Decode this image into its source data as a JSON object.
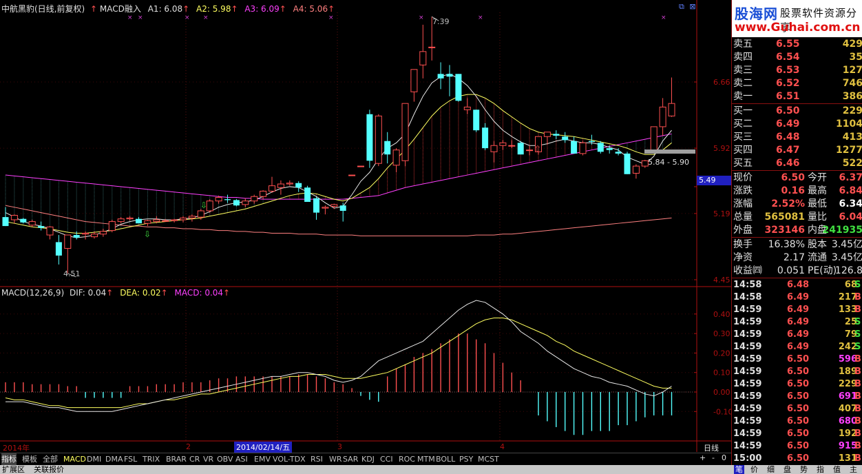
{
  "header": {
    "title": "中航黑豹(日线,前复权)",
    "indicator": "MACD融入",
    "a1": "A1: 6.08",
    "a2": "A2: 5.98",
    "a3": "A3: 6.09",
    "a4": "A4: 5.06"
  },
  "macd_header": {
    "label": "MACD(12,26,9)",
    "dif": "DIF: 0.04",
    "dea": "DEA: 0.02",
    "macd": "MACD: 0.04"
  },
  "annotations": {
    "high": "7.39",
    "low": "4.51",
    "range": "5.84 - 5.90",
    "current_price_tag": "5.49"
  },
  "x_labels": {
    "year": "2014年",
    "m2": "2",
    "date": "2014/02/14/五",
    "m3": "3",
    "m4": "4",
    "period": "日线"
  },
  "colors": {
    "up": "#ff5050",
    "down": "#54ffff",
    "ma_white": "#e8e8e8",
    "ma_yellow": "#ffff60",
    "ma_magenta": "#ff40ff",
    "ma_pink": "#ff8080",
    "axis_red": "#b01010",
    "blue_tag": "#2020c0"
  },
  "chart_data": [
    {
      "type": "candlestick",
      "title": "中航黑豹(日线,前复权)",
      "y_ticks": [
        4.45,
        5.19,
        5.49,
        5.92,
        6.66
      ],
      "ylim": [
        4.45,
        7.4
      ],
      "ohlc": [
        [
          5.15,
          5.26,
          5.05,
          5.05
        ],
        [
          5.12,
          5.18,
          5.08,
          5.17
        ],
        [
          5.13,
          5.14,
          5.08,
          5.09
        ],
        [
          5.06,
          5.12,
          5.04,
          5.1
        ],
        [
          5.05,
          5.1,
          5.0,
          5.03
        ],
        [
          4.95,
          5.05,
          4.9,
          5.04
        ],
        [
          4.87,
          4.95,
          4.62,
          4.72
        ],
        [
          4.8,
          4.95,
          4.52,
          4.95
        ],
        [
          4.95,
          4.99,
          4.9,
          4.92
        ],
        [
          4.96,
          4.99,
          4.9,
          4.97
        ],
        [
          4.93,
          4.99,
          4.91,
          4.96
        ],
        [
          4.96,
          5.02,
          4.93,
          4.99
        ],
        [
          5.0,
          5.12,
          4.98,
          5.1
        ],
        [
          5.1,
          5.15,
          5.08,
          5.13
        ],
        [
          5.13,
          5.16,
          5.11,
          5.14
        ],
        [
          5.13,
          5.15,
          5.08,
          5.08
        ],
        [
          5.08,
          5.12,
          5.05,
          5.11
        ],
        [
          5.1,
          5.16,
          5.08,
          5.12
        ],
        [
          5.11,
          5.13,
          5.1,
          5.11
        ],
        [
          5.11,
          5.13,
          5.09,
          5.12
        ],
        [
          5.12,
          5.16,
          5.09,
          5.14
        ],
        [
          5.14,
          5.18,
          5.1,
          5.16
        ],
        [
          5.15,
          5.24,
          5.12,
          5.22
        ],
        [
          5.22,
          5.35,
          5.2,
          5.33
        ],
        [
          5.33,
          5.39,
          5.3,
          5.37
        ],
        [
          5.35,
          5.4,
          5.31,
          5.34
        ],
        [
          5.34,
          5.35,
          5.27,
          5.28
        ],
        [
          5.29,
          5.36,
          5.26,
          5.33
        ],
        [
          5.33,
          5.4,
          5.3,
          5.38
        ],
        [
          5.38,
          5.45,
          5.35,
          5.44
        ],
        [
          5.44,
          5.6,
          5.42,
          5.5
        ],
        [
          5.48,
          5.56,
          5.4,
          5.52
        ],
        [
          5.52,
          5.56,
          5.5,
          5.53
        ],
        [
          5.53,
          5.55,
          5.43,
          5.48
        ],
        [
          5.48,
          5.5,
          5.32,
          5.32
        ],
        [
          5.36,
          5.38,
          5.12,
          5.2
        ],
        [
          5.25,
          5.28,
          5.18,
          5.26
        ],
        [
          5.27,
          5.3,
          5.24,
          5.29
        ],
        [
          5.28,
          5.31,
          5.1,
          5.22
        ],
        [
          5.62,
          5.62,
          5.62,
          5.62
        ],
        [
          5.72,
          5.72,
          5.72,
          5.72
        ],
        [
          6.3,
          6.35,
          5.7,
          5.78
        ],
        [
          5.75,
          6.3,
          5.72,
          6.28
        ],
        [
          6.0,
          6.1,
          5.75,
          5.85
        ],
        [
          5.73,
          5.92,
          5.65,
          5.9
        ],
        [
          5.78,
          6.42,
          5.72,
          6.42
        ],
        [
          6.55,
          6.8,
          6.44,
          6.8
        ],
        [
          6.85,
          7.3,
          6.7,
          7.0
        ],
        [
          7.05,
          7.39,
          6.9,
          7.05
        ],
        [
          6.75,
          6.88,
          6.58,
          6.7
        ],
        [
          6.75,
          6.85,
          6.5,
          6.72
        ],
        [
          6.75,
          6.75,
          6.44,
          6.45
        ],
        [
          6.35,
          6.48,
          6.3,
          6.38
        ],
        [
          6.35,
          6.35,
          6.1,
          6.12
        ],
        [
          6.15,
          6.2,
          5.9,
          5.92
        ],
        [
          5.88,
          6.0,
          5.76,
          5.95
        ],
        [
          5.95,
          6.01,
          5.9,
          5.98
        ],
        [
          5.95,
          6.01,
          5.92,
          5.95
        ],
        [
          5.98,
          6.0,
          5.85,
          5.85
        ],
        [
          5.9,
          5.95,
          5.84,
          5.9
        ],
        [
          5.88,
          6.05,
          5.85,
          6.05
        ],
        [
          6.05,
          6.1,
          5.96,
          6.1
        ],
        [
          6.08,
          6.12,
          6.02,
          6.06
        ],
        [
          6.05,
          6.1,
          5.98,
          6.01
        ],
        [
          6.0,
          6.05,
          5.86,
          5.86
        ],
        [
          5.86,
          6.0,
          5.84,
          5.98
        ],
        [
          6.0,
          6.07,
          5.96,
          5.99
        ],
        [
          5.98,
          6.0,
          5.86,
          5.88
        ],
        [
          5.92,
          5.95,
          5.86,
          5.9
        ],
        [
          5.88,
          5.92,
          5.84,
          5.86
        ],
        [
          5.86,
          5.88,
          5.63,
          5.63
        ],
        [
          5.64,
          5.74,
          5.58,
          5.72
        ],
        [
          5.72,
          5.79,
          5.7,
          5.78
        ],
        [
          5.9,
          6.16,
          5.88,
          6.16
        ],
        [
          6.16,
          6.48,
          6.06,
          6.38
        ],
        [
          6.28,
          6.71,
          6.27,
          6.42
        ]
      ],
      "ma": {
        "white": [
          5.2,
          5.15,
          5.1,
          5.07,
          5.05,
          5.02,
          4.98,
          4.94,
          4.92,
          4.93,
          4.95,
          4.98,
          5.02,
          5.07,
          5.1,
          5.12,
          5.13,
          5.13,
          5.12,
          5.12,
          5.13,
          5.14,
          5.17,
          5.21,
          5.26,
          5.29,
          5.31,
          5.32,
          5.34,
          5.38,
          5.43,
          5.47,
          5.49,
          5.48,
          5.43,
          5.38,
          5.31,
          5.25,
          5.27,
          5.4,
          5.55,
          5.65,
          5.8,
          5.92,
          5.98,
          6.08,
          6.3,
          6.5,
          6.65,
          6.72,
          6.75,
          6.7,
          6.62,
          6.5,
          6.35,
          6.22,
          6.12,
          6.05,
          5.99,
          5.95,
          5.95,
          5.97,
          6.0,
          6.02,
          6.0,
          5.98,
          5.98,
          5.96,
          5.93,
          5.9,
          5.82,
          5.78,
          5.74,
          5.83,
          6.0,
          6.12
        ],
        "yellow": [
          5.1,
          5.08,
          5.06,
          5.04,
          5.03,
          5.02,
          5.0,
          4.98,
          4.97,
          4.97,
          4.98,
          4.99,
          5.0,
          5.02,
          5.04,
          5.06,
          5.08,
          5.09,
          5.1,
          5.11,
          5.12,
          5.13,
          5.14,
          5.16,
          5.18,
          5.2,
          5.22,
          5.24,
          5.27,
          5.3,
          5.33,
          5.36,
          5.39,
          5.41,
          5.42,
          5.41,
          5.38,
          5.35,
          5.33,
          5.36,
          5.42,
          5.48,
          5.58,
          5.7,
          5.8,
          5.9,
          6.02,
          6.15,
          6.28,
          6.38,
          6.45,
          6.5,
          6.52,
          6.52,
          6.48,
          6.42,
          6.34,
          6.27,
          6.2,
          6.14,
          6.1,
          6.08,
          6.07,
          6.06,
          6.05,
          6.03,
          6.01,
          5.99,
          5.97,
          5.95,
          5.92,
          5.88,
          5.85,
          5.85,
          5.9,
          5.98
        ],
        "magenta": [
          5.62,
          5.61,
          5.6,
          5.59,
          5.58,
          5.57,
          5.56,
          5.55,
          5.54,
          5.53,
          5.52,
          5.51,
          5.5,
          5.49,
          5.48,
          5.47,
          5.46,
          5.45,
          5.44,
          5.43,
          5.42,
          5.41,
          5.4,
          5.39,
          5.38,
          5.37,
          5.37,
          5.36,
          5.36,
          5.35,
          5.35,
          5.35,
          5.35,
          5.35,
          5.35,
          5.35,
          5.35,
          5.35,
          5.35,
          5.36,
          5.37,
          5.38,
          5.39,
          5.42,
          5.45,
          5.48,
          5.5,
          5.52,
          5.54,
          5.56,
          5.58,
          5.6,
          5.62,
          5.64,
          5.66,
          5.68,
          5.7,
          5.72,
          5.74,
          5.76,
          5.78,
          5.8,
          5.82,
          5.84,
          5.86,
          5.88,
          5.9,
          5.92,
          5.94,
          5.96,
          5.98,
          6.0,
          6.02,
          6.04,
          6.06,
          6.08
        ],
        "pink": [
          5.28,
          5.26,
          5.24,
          5.22,
          5.2,
          5.18,
          5.16,
          5.14,
          5.12,
          5.1,
          5.09,
          5.08,
          5.07,
          5.06,
          5.05,
          5.05,
          5.04,
          5.04,
          5.03,
          5.03,
          5.02,
          5.02,
          5.01,
          5.01,
          5.0,
          5.0,
          4.99,
          4.99,
          4.98,
          4.98,
          4.97,
          4.97,
          4.97,
          4.96,
          4.96,
          4.96,
          4.95,
          4.95,
          4.95,
          4.95,
          4.94,
          4.94,
          4.94,
          4.94,
          4.94,
          4.94,
          4.94,
          4.94,
          4.94,
          4.94,
          4.94,
          4.94,
          4.94,
          4.95,
          4.95,
          4.95,
          4.96,
          4.96,
          4.97,
          4.98,
          4.99,
          5.0,
          5.01,
          5.02,
          5.03,
          5.04,
          5.05,
          5.06,
          5.07,
          5.08,
          5.09,
          5.1,
          5.11,
          5.12,
          5.13,
          5.14
        ]
      }
    },
    {
      "type": "bar+line",
      "title": "MACD(12,26,9)",
      "y_ticks": [
        0.4,
        0.3,
        0.2,
        0.1,
        0.0,
        -0.1
      ],
      "ylim": [
        -0.22,
        0.46
      ],
      "macd": [
        0.05,
        0.05,
        0.05,
        0.04,
        0.04,
        0.04,
        0.04,
        0.03,
        0.03,
        -0.03,
        -0.03,
        -0.03,
        -0.03,
        -0.03,
        0.03,
        0.03,
        0.03,
        0.04,
        0.04,
        0.04,
        0.05,
        0.05,
        0.05,
        0.06,
        0.07,
        0.07,
        0.08,
        0.08,
        0.08,
        0.08,
        0.08,
        0.08,
        0.08,
        0.09,
        0.09,
        0.08,
        0.07,
        0.05,
        0.04,
        0.02,
        -0.02,
        -0.04,
        -0.05,
        0.08,
        0.12,
        0.14,
        0.18,
        0.2,
        0.22,
        0.25,
        0.27,
        0.3,
        0.3,
        0.27,
        0.25,
        0.2,
        0.15,
        0.1,
        0.06,
        0.0,
        -0.12,
        -0.15,
        -0.18,
        -0.2,
        -0.22,
        -0.22,
        -0.2,
        -0.2,
        -0.2,
        -0.17,
        -0.17,
        -0.15,
        -0.13,
        -0.12,
        -0.12,
        -0.12
      ],
      "dif": [
        -0.05,
        -0.05,
        -0.05,
        -0.06,
        -0.07,
        -0.08,
        -0.08,
        -0.09,
        -0.1,
        -0.1,
        -0.1,
        -0.1,
        -0.1,
        -0.09,
        -0.08,
        -0.07,
        -0.06,
        -0.05,
        -0.04,
        -0.03,
        -0.02,
        -0.01,
        0.0,
        0.01,
        0.02,
        0.03,
        0.04,
        0.05,
        0.06,
        0.07,
        0.08,
        0.08,
        0.09,
        0.1,
        0.1,
        0.09,
        0.08,
        0.06,
        0.05,
        0.06,
        0.08,
        0.12,
        0.16,
        0.18,
        0.2,
        0.22,
        0.24,
        0.26,
        0.3,
        0.34,
        0.38,
        0.42,
        0.45,
        0.47,
        0.46,
        0.43,
        0.4,
        0.36,
        0.31,
        0.28,
        0.25,
        0.21,
        0.18,
        0.15,
        0.12,
        0.1,
        0.08,
        0.07,
        0.05,
        0.04,
        0.03,
        0.01,
        -0.01,
        -0.02,
        0.0,
        0.03
      ],
      "dea": [
        -0.03,
        -0.04,
        -0.04,
        -0.05,
        -0.06,
        -0.07,
        -0.07,
        -0.08,
        -0.08,
        -0.08,
        -0.08,
        -0.08,
        -0.08,
        -0.08,
        -0.07,
        -0.06,
        -0.06,
        -0.05,
        -0.04,
        -0.04,
        -0.03,
        -0.02,
        -0.01,
        -0.01,
        0.0,
        0.01,
        0.02,
        0.03,
        0.04,
        0.05,
        0.06,
        0.07,
        0.08,
        0.08,
        0.09,
        0.09,
        0.09,
        0.08,
        0.07,
        0.07,
        0.07,
        0.08,
        0.09,
        0.1,
        0.12,
        0.14,
        0.16,
        0.18,
        0.2,
        0.23,
        0.26,
        0.29,
        0.32,
        0.35,
        0.37,
        0.38,
        0.38,
        0.37,
        0.35,
        0.33,
        0.31,
        0.29,
        0.26,
        0.24,
        0.21,
        0.19,
        0.17,
        0.15,
        0.13,
        0.11,
        0.09,
        0.07,
        0.05,
        0.03,
        0.02,
        0.02
      ]
    }
  ],
  "quote": {
    "sell": [
      {
        "label": "卖五",
        "price": "6.55",
        "vol": "429"
      },
      {
        "label": "卖四",
        "price": "6.54",
        "vol": "35"
      },
      {
        "label": "卖三",
        "price": "6.53",
        "vol": "127"
      },
      {
        "label": "卖二",
        "price": "6.52",
        "vol": "746"
      },
      {
        "label": "卖一",
        "price": "6.51",
        "vol": "386"
      }
    ],
    "buy": [
      {
        "label": "买一",
        "price": "6.50",
        "vol": "229"
      },
      {
        "label": "买二",
        "price": "6.49",
        "vol": "1104"
      },
      {
        "label": "买三",
        "price": "6.48",
        "vol": "413"
      },
      {
        "label": "买四",
        "price": "6.47",
        "vol": "1277"
      },
      {
        "label": "买五",
        "price": "6.46",
        "vol": "522"
      }
    ],
    "stats": [
      {
        "l1": "现价",
        "v1": "6.50",
        "l2": "今开",
        "v2": "6.37"
      },
      {
        "l1": "涨跌",
        "v1": "0.16",
        "l2": "最高",
        "v2": "6.84"
      },
      {
        "l1": "涨幅",
        "v1": "2.52%",
        "l2": "最低",
        "v2": "6.34"
      },
      {
        "l1": "总量",
        "v1": "565081",
        "l2": "量比",
        "v2": "6.04"
      },
      {
        "l1": "外盘",
        "v1": "323146",
        "l2": "内盘",
        "v2": "241935"
      }
    ],
    "fund": [
      {
        "l1": "换手",
        "v1": "16.38%",
        "l2": "股本",
        "v2": "3.45亿"
      },
      {
        "l1": "净资",
        "v1": "2.17",
        "l2": "流通",
        "v2": "3.45亿"
      },
      {
        "l1": "收益㈣",
        "v1": "0.051",
        "l2": "PE(动)",
        "v2": "126.8"
      }
    ],
    "ticks": [
      {
        "t": "14:58",
        "p": "6.48",
        "v": "68",
        "s": "S"
      },
      {
        "t": "14:58",
        "p": "6.49",
        "v": "217",
        "s": "B"
      },
      {
        "t": "14:59",
        "p": "6.49",
        "v": "133",
        "s": "B"
      },
      {
        "t": "14:59",
        "p": "6.49",
        "v": "25",
        "s": "S"
      },
      {
        "t": "14:59",
        "p": "6.49",
        "v": "79",
        "s": "S"
      },
      {
        "t": "14:59",
        "p": "6.49",
        "v": "242",
        "s": "S"
      },
      {
        "t": "14:59",
        "p": "6.50",
        "v": "596",
        "s": "B"
      },
      {
        "t": "14:59",
        "p": "6.50",
        "v": "189",
        "s": "B"
      },
      {
        "t": "14:59",
        "p": "6.50",
        "v": "229",
        "s": "B"
      },
      {
        "t": "14:59",
        "p": "6.50",
        "v": "691",
        "s": "B"
      },
      {
        "t": "14:59",
        "p": "6.50",
        "v": "407",
        "s": "B"
      },
      {
        "t": "14:59",
        "p": "6.50",
        "v": "680",
        "s": "B"
      },
      {
        "t": "14:59",
        "p": "6.50",
        "v": "192",
        "s": "B"
      },
      {
        "t": "14:59",
        "p": "6.50",
        "v": "915",
        "s": "B"
      },
      {
        "t": "15:00",
        "p": "6.50",
        "v": "131",
        "s": "B"
      }
    ]
  },
  "logo": {
    "name": "股海网",
    "slogan": "股票软件资源分享",
    "url": "www.Guhai.com.cn"
  },
  "tabs": [
    "指标",
    "模板",
    "全部",
    "MACD",
    "DMI",
    "DMA",
    "FSL",
    "TRIX",
    "BRAR",
    "CR",
    "VR",
    "OBV",
    "ASI",
    "EMV",
    "VOL-TDX",
    "RSI",
    "WR",
    "SAR",
    "KDJ",
    "CCI",
    "ROC",
    "MTM",
    "BOLL",
    "PSY",
    "MCST"
  ],
  "zoom": {
    "plus": "+",
    "minus": "-",
    "zero": "0"
  },
  "bottom_tabs": [
    "扩展区",
    "关联报价"
  ],
  "bottom_right": [
    "笔",
    "价",
    "细",
    "盘",
    "势",
    "指",
    "值",
    "主"
  ]
}
